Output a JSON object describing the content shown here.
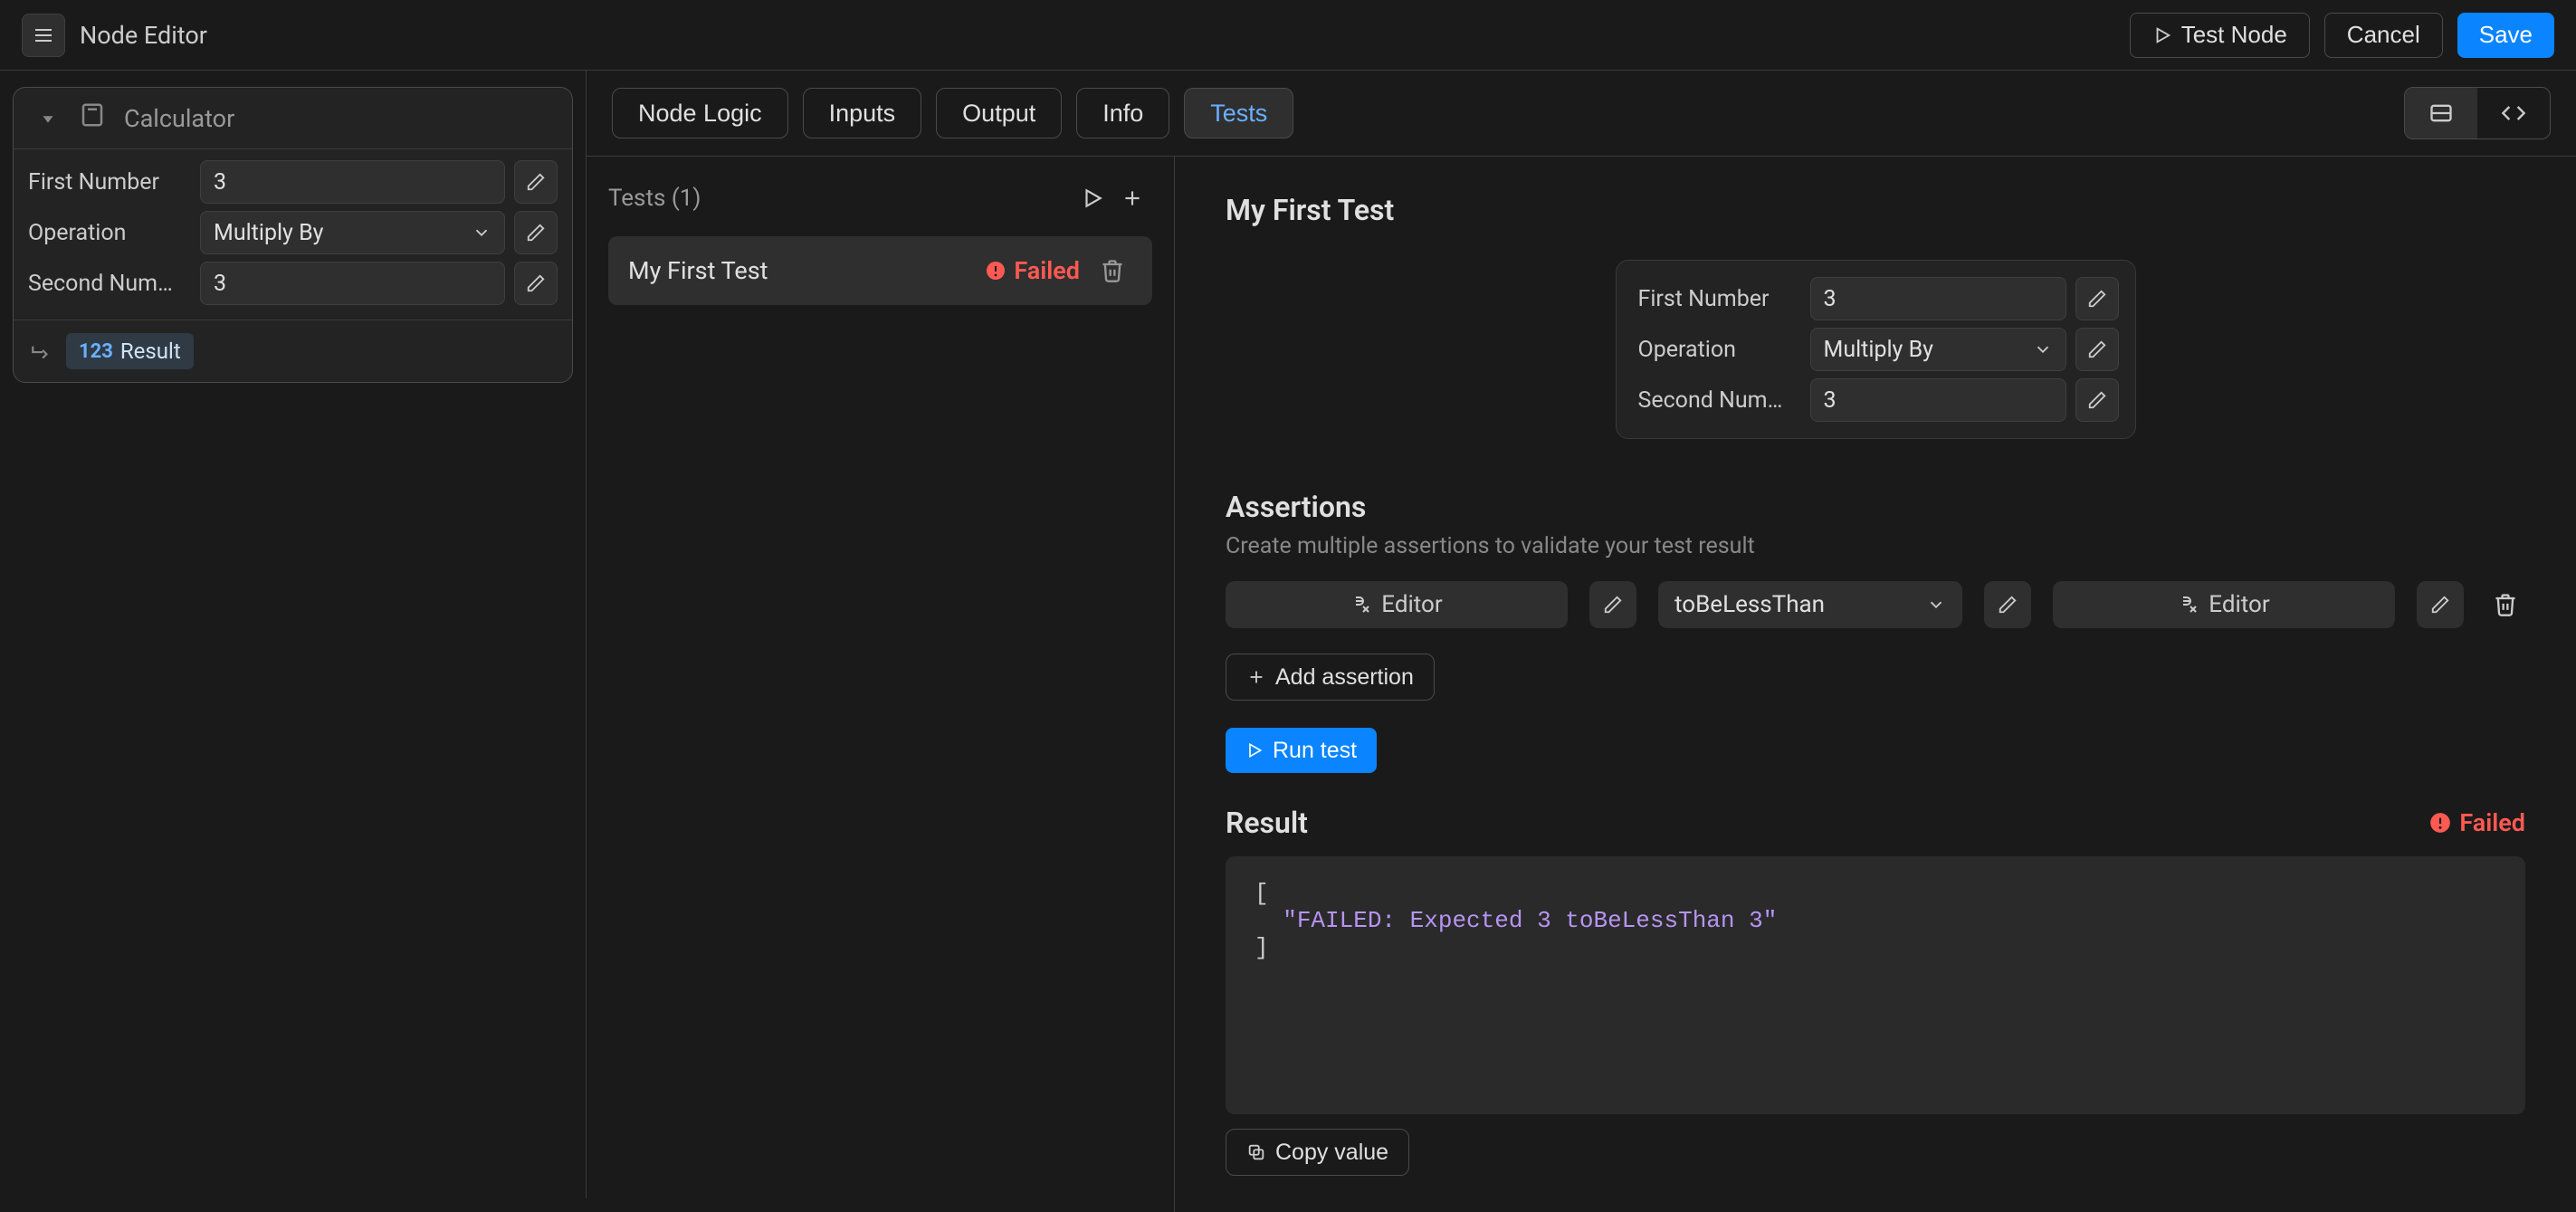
{
  "header": {
    "title": "Node Editor",
    "test_node": "Test Node",
    "cancel": "Cancel",
    "save": "Save"
  },
  "node_card": {
    "title": "Calculator",
    "fields": {
      "first_label": "First Number",
      "first_value": "3",
      "op_label": "Operation",
      "op_value": "Multiply By",
      "second_label": "Second Num…",
      "second_value": "3"
    },
    "result_chip": "Result"
  },
  "tabs": {
    "node_logic": "Node Logic",
    "inputs": "Inputs",
    "output": "Output",
    "info": "Info",
    "tests": "Tests"
  },
  "tests_list": {
    "header": "Tests (1)",
    "items": [
      {
        "label": "My First Test",
        "status": "Failed"
      }
    ]
  },
  "detail": {
    "title": "My First Test",
    "inputs_card": {
      "first_label": "First Number",
      "first_value": "3",
      "op_label": "Operation",
      "op_value": "Multiply By",
      "second_label": "Second Num…",
      "second_value": "3"
    },
    "assertions_title": "Assertions",
    "assertions_sub": "Create multiple assertions to validate your test result",
    "assertion_row": {
      "left_label": "Editor",
      "comparator": "toBeLessThan",
      "right_label": "Editor"
    },
    "add_assertion": "Add assertion",
    "run_test": "Run test",
    "result_title": "Result",
    "result_status": "Failed",
    "code": {
      "open": "[",
      "str": "\"FAILED: Expected 3 toBeLessThan 3\"",
      "close": "]"
    },
    "copy_value": "Copy value"
  }
}
